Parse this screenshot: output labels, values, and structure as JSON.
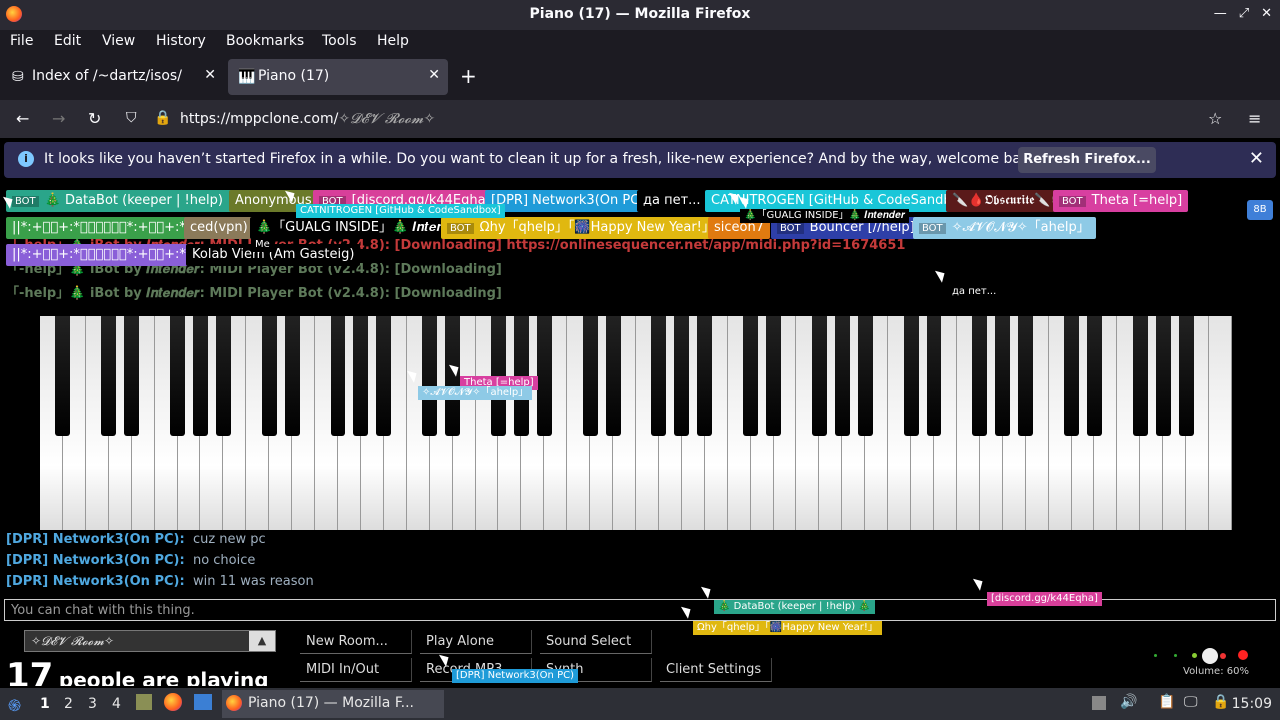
{
  "window": {
    "title": "Piano (17) — Mozilla Firefox"
  },
  "menu": [
    "File",
    "Edit",
    "View",
    "History",
    "Bookmarks",
    "Tools",
    "Help"
  ],
  "tabs": [
    {
      "label": "Index of /~dartz/isos/",
      "active": false
    },
    {
      "label": "Piano (17)",
      "active": true
    }
  ],
  "nav": {
    "url_domain": "https://mppclone.com/",
    "url_path": "✧𝓓𝓔𝓥 𝓡𝓸𝓸𝓶✧"
  },
  "notification": {
    "message": "It looks like you haven’t started Firefox in a while. Do you want to clean it up for a fresh, like-new experience? And by the way, welcome back!",
    "button": "Refresh Firefox..."
  },
  "users": [
    {
      "bot": "BOT",
      "name": "🎄 DataBot (keeper | !help) 🎄",
      "color": "#2aa58a"
    },
    {
      "bot": "",
      "name": "Anonymous",
      "color": "#6b7a2a"
    },
    {
      "bot": "BOT",
      "name": "[discord.gg/k44Eqha]",
      "color": "#d83f9a"
    },
    {
      "bot": "",
      "name": "[DPR] Network3(On PC)",
      "color": "#1f9bd8"
    },
    {
      "bot": "",
      "name": "да пет...",
      "color": "#000000"
    },
    {
      "bot": "",
      "name": "CATNITROGEN [GitHub & CodeSandbox]",
      "color": "#19c6d8"
    },
    {
      "bot": "",
      "name": "🔪🩸𝕺𝖇𝖘𝖈𝖚𝖗𝖎𝖙𝖊🔪💀",
      "color": "#5a1a1a"
    },
    {
      "bot": "BOT",
      "name": "Theta [=help]",
      "color": "#d83fa0"
    },
    {
      "bot": "",
      "name": "||*:+ﾟﾟ+:*𝒷𝓎𝒮𝓉𝑒𝓅*:+ﾟﾟ+:*|| 🎄",
      "color": "#3aa04a"
    },
    {
      "bot": "",
      "name": "ced(vpn)",
      "color": "#8b7a5a"
    },
    {
      "bot": "",
      "name": "🎄「GUALG INSIDE」🎄 𝑰𝒏𝒕𝒆𝒏𝒅𝒆𝒓",
      "color": "#000000"
    },
    {
      "bot": "BOT",
      "name": "Ωhy「qhelp」「🎆Happy New Year!」",
      "color": "#e0b810"
    },
    {
      "bot": "",
      "name": "siceon7",
      "color": "#e07a10"
    },
    {
      "bot": "BOT",
      "name": "Bouncer [//help]",
      "color": "#2e3fa8"
    },
    {
      "bot": "BOT",
      "name": "✧𝓐𝓥𝓞𝓝𝓨✧「ahelp」",
      "color": "#8ecae6"
    },
    {
      "bot": "",
      "name": "||*:+ﾟﾟ+:*𝒷𝓎𝒮𝓉𝑒𝓅*:+ﾟﾟ+:*|| 🎄",
      "color": "#8a5fd8"
    },
    {
      "bot": "",
      "name": "Kolab Viem (Am Gasteig)",
      "color": "#000000"
    }
  ],
  "chat_ghost": [
    "「-help」🎄 iBot by 𝑰𝒏𝒕𝒆𝒏𝒅𝒆𝒓:  MIDI Player Bot (v2.4.8): [Downloading] https://onlinesequencer.net/app/midi.php?id=1674651",
    "「-help」🎄 iBot by 𝑰𝒏𝒕𝒆𝒏𝒅𝒆𝒓:  MIDI Player Bot (v2.4.8): [Downloading]",
    "「-help」🎄 iBot by 𝑰𝒏𝒕𝒆𝒏𝒅𝒆𝒓:  MIDI Player Bot (v2.4.8): [Downloading]"
  ],
  "chat": [
    {
      "name": "[DPR] Network3(On PC):",
      "msg": "cuz new pc"
    },
    {
      "name": "[DPR] Network3(On PC):",
      "msg": "no choice"
    },
    {
      "name": "[DPR] Network3(On PC):",
      "msg": "win 11 was reason"
    }
  ],
  "chat_placeholder": "You can chat with this thing.",
  "room": {
    "name": "✧𝓓𝓔𝓥 𝓡𝓸𝓸𝓶✧",
    "count": "17",
    "count_text": "people are playing"
  },
  "controls": [
    "New Room...",
    "Play Alone",
    "Sound Select",
    "MIDI In/Out",
    "Record MP3",
    "Synth",
    "Client Settings"
  ],
  "volume": "Volume: 60%",
  "cursor_tags": [
    {
      "text": "CATNITROGEN [GitHub & CodeSandbox]",
      "color": "#19c6d8"
    },
    {
      "text": "🎄「GUALG INSIDE」🎄 𝑰𝒏𝒕𝒆𝒏𝒅𝒆𝒓",
      "color": "#000000"
    },
    {
      "text": "Me",
      "color": "#000000"
    },
    {
      "text": "да пет...",
      "color": "#000000"
    },
    {
      "text": "Theta [=help]",
      "color": "#d83fa0"
    },
    {
      "text": "✧𝓐𝓥𝓞𝓝𝓨✧「ahelp」",
      "color": "#8ecae6"
    },
    {
      "text": "🎄 DataBot (keeper | !help) 🎄",
      "color": "#2aa58a"
    },
    {
      "text": "[discord.gg/k44Eqha]",
      "color": "#d83f9a"
    },
    {
      "text": "Ωhy「qhelp」「🎆Happy New Year!」",
      "color": "#e0b810"
    },
    {
      "text": "[DPR] Network3(On PC)",
      "color": "#1f9bd8"
    }
  ],
  "taskbar": {
    "workspaces": [
      "1",
      "2",
      "3",
      "4"
    ],
    "task": "Piano (17) — Mozilla F...",
    "clock": "15:09"
  },
  "badge": "8B"
}
